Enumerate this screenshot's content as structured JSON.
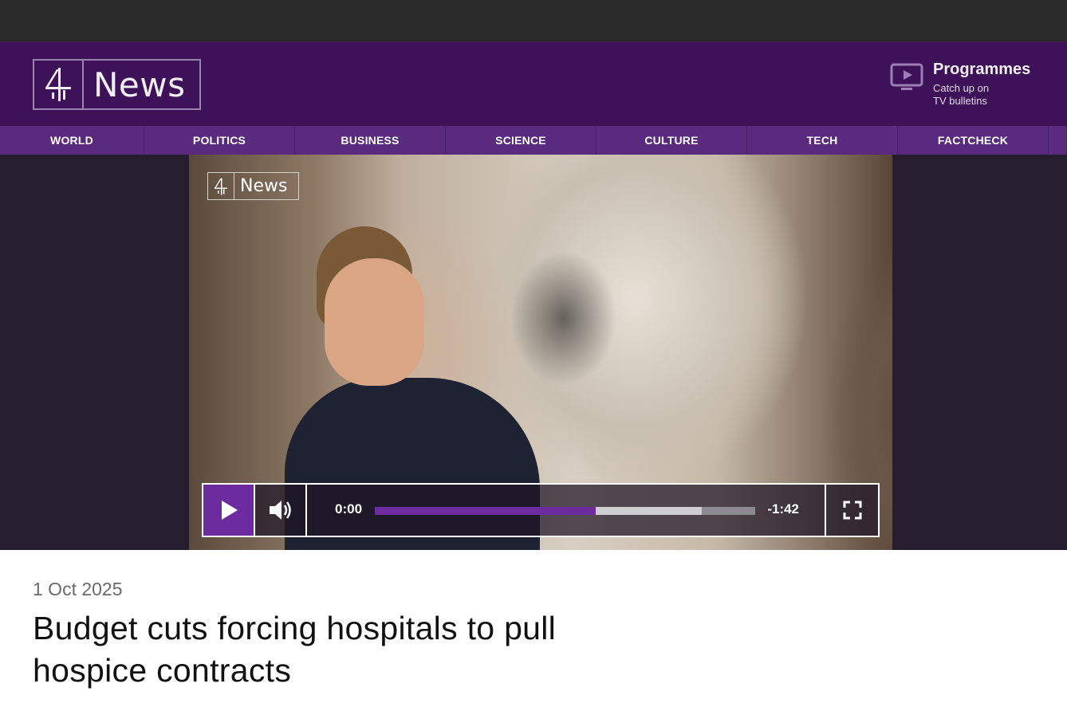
{
  "masthead": {
    "logo_text": "News",
    "programmes": {
      "title": "Programmes",
      "subtitle_line1": "Catch up on",
      "subtitle_line2": "TV bulletins"
    }
  },
  "nav": {
    "items": [
      {
        "label": "WORLD"
      },
      {
        "label": "POLITICS"
      },
      {
        "label": "BUSINESS"
      },
      {
        "label": "SCIENCE"
      },
      {
        "label": "CULTURE"
      },
      {
        "label": "TECH"
      },
      {
        "label": "FACTCHECK"
      }
    ]
  },
  "video": {
    "watermark_text": "News",
    "controls": {
      "current_time": "0:00",
      "remaining_time": "-1:42",
      "played_fraction": 0.0,
      "seek_fill_fraction": 0.58,
      "buffered_fraction": 0.86
    }
  },
  "article": {
    "date": "1 Oct 2025",
    "headline": "Budget cuts forcing hospitals to pull hospice contracts"
  },
  "colors": {
    "brand_purple": "#3e1258",
    "nav_purple": "#5a2a7e",
    "accent": "#6c2c9f"
  },
  "icons": {
    "logo": "channel4-logo-icon",
    "programmes": "tv-play-icon",
    "play": "play-icon",
    "volume": "volume-icon",
    "fullscreen": "fullscreen-icon"
  }
}
